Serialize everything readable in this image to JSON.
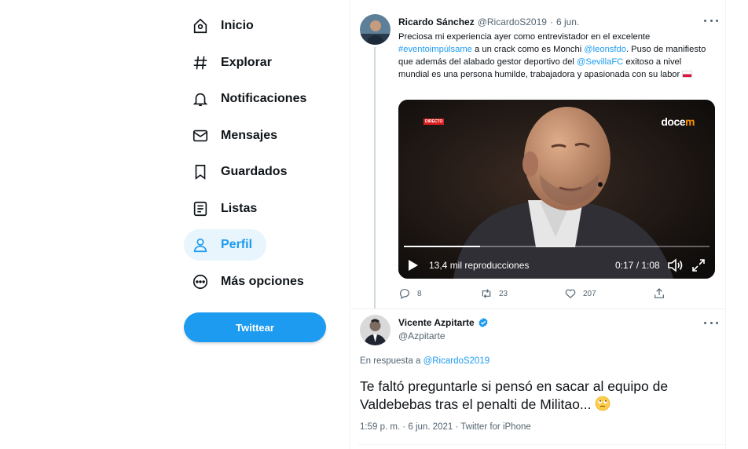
{
  "nav": {
    "items": [
      {
        "label": "Inicio",
        "icon": "home-icon"
      },
      {
        "label": "Explorar",
        "icon": "hashtag-icon"
      },
      {
        "label": "Notificaciones",
        "icon": "bell-icon"
      },
      {
        "label": "Mensajes",
        "icon": "envelope-icon"
      },
      {
        "label": "Guardados",
        "icon": "bookmark-icon"
      },
      {
        "label": "Listas",
        "icon": "list-icon"
      },
      {
        "label": "Perfil",
        "icon": "person-icon",
        "active": true
      },
      {
        "label": "Más opciones",
        "icon": "more-circle-icon"
      }
    ],
    "tweet_button": "Twittear"
  },
  "tweet1": {
    "name": "Ricardo Sánchez",
    "handle": "@RicardoS2019",
    "separator": "·",
    "date": "6 jun.",
    "text_1": "Preciosa mi experiencia ayer como entrevistador en el excelente",
    "hashtag": "#eventoimpúlsame",
    "text_2": " a un crack como es Monchi ",
    "mention_1": "@leonsfdo",
    "text_3": ". Puso de manifiesto que además del alabado gestor deportivo del ",
    "mention_2": "@SevillaFC",
    "text_4": " exitoso a nivel mundial es una persona humilde, trabajadora y apasionada con su labor ",
    "video": {
      "live_badge": "DIRECTO",
      "brand_prefix": "doce",
      "brand_suffix": "m",
      "views": "13,4 mil reproducciones",
      "time": "0:17 / 1:08",
      "progress": 0.25
    },
    "replies": "8",
    "retweets": "23",
    "likes": "207"
  },
  "tweet2": {
    "name": "Vicente Azpitarte",
    "handle": "@Azpitarte",
    "reply_prefix": "En respuesta a ",
    "reply_to": "@RicardoS2019",
    "text": "Te faltó preguntarle si pensó en sacar al equipo de Valdebebas tras el penalti de Militao... ",
    "meta": "1:59 p. m. · 6 jun. 2021 · Twitter for iPhone"
  },
  "colors": {
    "accent": "#1d9bf0",
    "text": "#0f1419",
    "muted": "#536471"
  }
}
